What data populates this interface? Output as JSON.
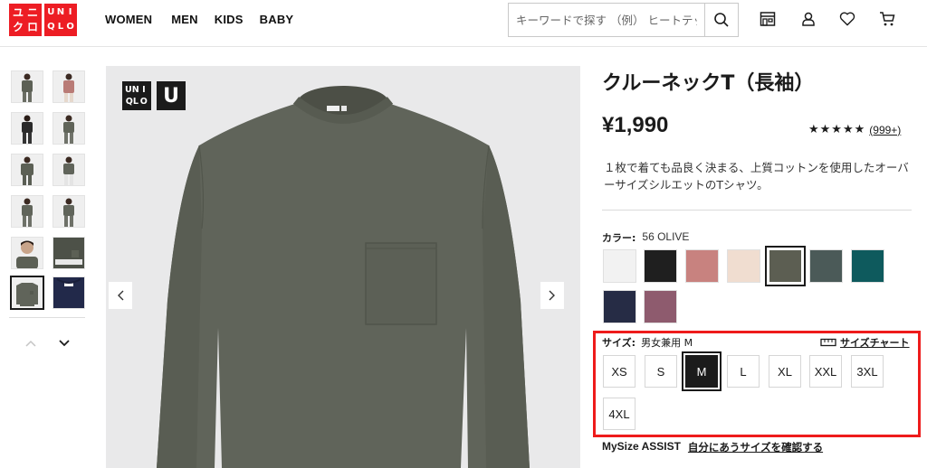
{
  "header": {
    "logo_top": [
      "ユ",
      "ニ",
      "ク",
      "ロ"
    ],
    "logo_bottom": [
      "U",
      "N",
      "I",
      "Q",
      "L",
      "O"
    ],
    "nav": [
      "WOMEN",
      "MEN",
      "KIDS",
      "BABY"
    ],
    "search_placeholder": "キーワードで探す （例） ヒートテック",
    "icons": [
      "search-icon",
      "store-icon",
      "account-icon",
      "heart-icon",
      "cart-icon"
    ]
  },
  "gallery": {
    "badge_uniqlo": [
      "UN",
      "I",
      "QL",
      "O"
    ],
    "badge_u": "U",
    "thumbnails": 12,
    "selected_thumbnail": 10
  },
  "product": {
    "title": "クルーネックT（長袖）",
    "price": "¥1,990",
    "stars": "★★★★★",
    "rating_value": 4.5,
    "review_count": "(999+)",
    "description": "１枚で着ても品良く決まる、上質コットンを使用したオーバーサイズシルエットのTシャツ。",
    "color_label": "カラー:",
    "color_value": "56 OLIVE",
    "colors": [
      "#f2f2f2",
      "#1f1f1f",
      "#c8827f",
      "#f0ddd0",
      "#5c5e52",
      "#4b5a58",
      "#0e5a5d",
      "#262c45",
      "#8e5b6e"
    ],
    "selected_color": 4,
    "size_label": "サイズ:",
    "size_value": "男女兼用 M",
    "size_chart": "サイズチャート",
    "sizes": [
      "XS",
      "S",
      "M",
      "L",
      "XL",
      "XXL",
      "3XL",
      "4XL"
    ],
    "selected_size": 2,
    "mysize_label": "MySize ASSIST",
    "mysize_link": "自分にあうサイズを確認する"
  },
  "theme": {
    "brand_red": "#ed1d24",
    "highlight_red": "#ee1b1b",
    "shirt_olive": "#60645a"
  }
}
